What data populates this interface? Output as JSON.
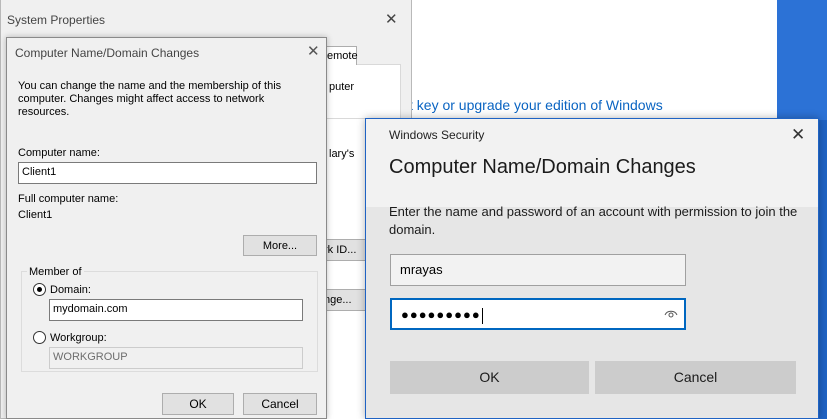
{
  "system_properties": {
    "title": "System Properties",
    "tab_label": "emote",
    "panel_text_1": "puter",
    "panel_text_2": "lary's",
    "network_id_button": "rk ID...",
    "change_button": "nge..."
  },
  "background_link": "ct key or upgrade your edition of Windows",
  "computer_name_dialog": {
    "title": "Computer Name/Domain Changes",
    "description": "You can change the name and the membership of this computer. Changes might affect access to network resources.",
    "computer_name_label": "Computer name:",
    "computer_name_value": "Client1",
    "full_name_label": "Full computer name:",
    "full_name_value": "Client1",
    "more_button": "More...",
    "member_of_label": "Member of",
    "domain_label": "Domain:",
    "domain_value": "mydomain.com",
    "workgroup_label": "Workgroup:",
    "workgroup_value": "WORKGROUP",
    "selected_membership": "Domain",
    "ok_button": "OK",
    "cancel_button": "Cancel"
  },
  "windows_security": {
    "brand": "Windows Security",
    "heading": "Computer Name/Domain Changes",
    "body": "Enter the name and password of an account with permission to join the domain.",
    "username_value": "mrayas",
    "password_masked": "●●●●●●●●●",
    "ok_button": "OK",
    "cancel_button": "Cancel",
    "accent_color": "#0067c0"
  }
}
